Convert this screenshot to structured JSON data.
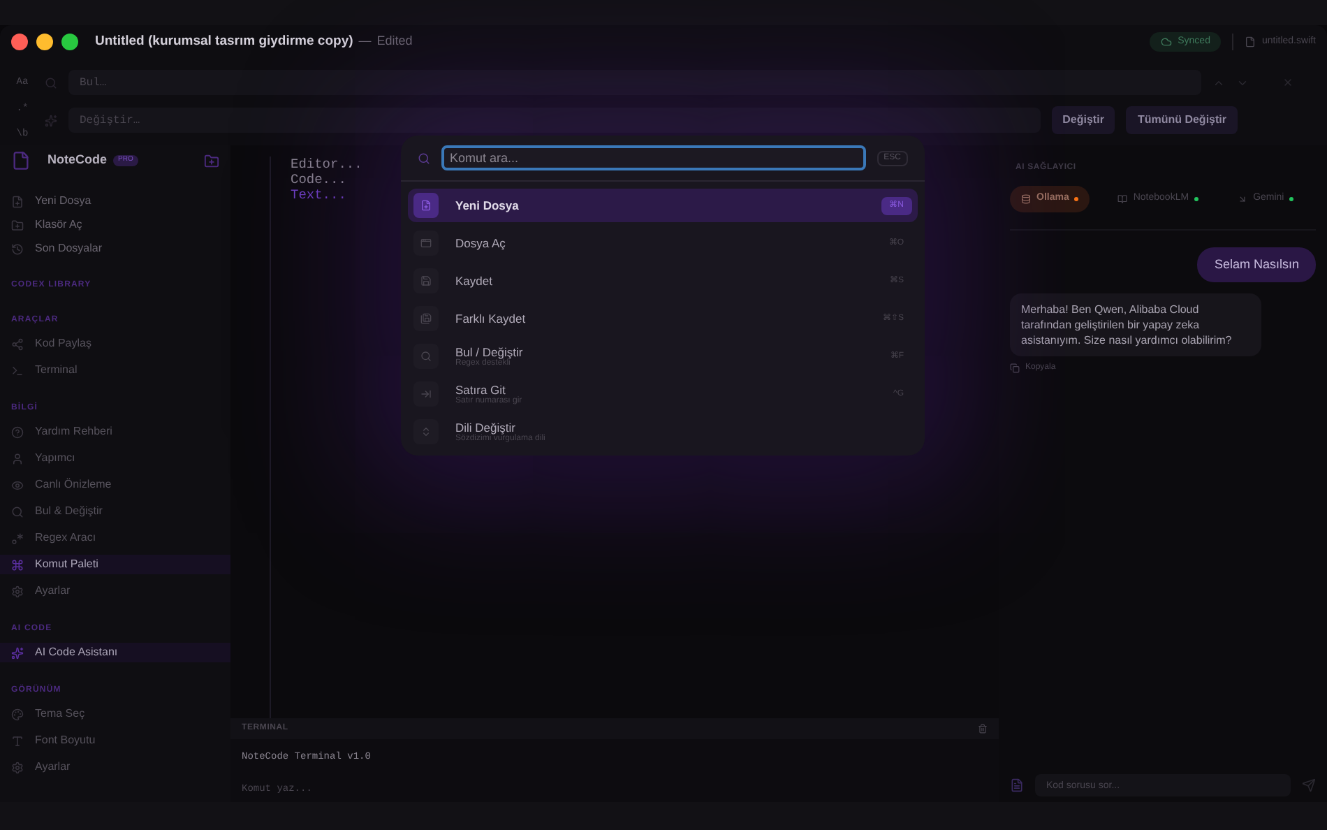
{
  "window": {
    "title": "Untitled (kurumsal tasrım giydirme copy)",
    "separator": "—",
    "edited": "Edited",
    "sync": "Synced",
    "file": "untitled.swift"
  },
  "find": {
    "toggles": [
      "Aa",
      ".*",
      "\\b"
    ],
    "find_placeholder": "Bul…",
    "replace_placeholder": "Değiştir…",
    "replace_button": "Değiştir",
    "replace_all_button": "Tümünü Değiştir"
  },
  "sidebar": {
    "brand": "NoteCode",
    "badge": "PRO",
    "top_items": [
      {
        "label": "Yeni Dosya"
      },
      {
        "label": "Klasör Aç"
      },
      {
        "label": "Son Dosyalar"
      }
    ],
    "sections": [
      {
        "title": "CODEX LIBRARY"
      },
      {
        "title": "ARAÇLAR",
        "items": [
          {
            "label": "Kod Paylaş",
            "selected": false
          },
          {
            "label": "Terminal",
            "selected": false
          }
        ]
      },
      {
        "title": "BİLGİ",
        "items": [
          {
            "label": "Yardım Rehberi",
            "selected": false
          },
          {
            "label": "Yapımcı",
            "selected": false
          },
          {
            "label": "Canlı Önizleme",
            "selected": false
          },
          {
            "label": "Bul & Değiştir",
            "selected": false
          },
          {
            "label": "Regex Aracı",
            "selected": false
          },
          {
            "label": "Komut Paleti",
            "selected": true
          },
          {
            "label": "Ayarlar",
            "selected": false
          }
        ]
      },
      {
        "title": "AI CODE",
        "items": [
          {
            "label": "AI Code Asistanı",
            "selected": true
          }
        ]
      },
      {
        "title": "GÖRÜNÜM",
        "items": [
          {
            "label": "Tema Seç",
            "selected": false
          },
          {
            "label": "Font Boyutu",
            "selected": false
          },
          {
            "label": "Ayarlar",
            "selected": false
          }
        ]
      }
    ]
  },
  "editor": {
    "lines": [
      "Editor...",
      "Code...",
      "Text..."
    ]
  },
  "terminal": {
    "title": "TERMINAL",
    "output": "NoteCode Terminal v1.0",
    "placeholder": "Komut yaz..."
  },
  "ai_panel": {
    "title": "AI SAĞLAYICI",
    "providers": [
      {
        "label": "Ollama",
        "selected": true,
        "color": "#f97316"
      },
      {
        "label": "NotebookLM",
        "selected": false,
        "color": "#22c55e"
      },
      {
        "label": "Gemini",
        "selected": false,
        "color": "#22c55e"
      }
    ],
    "messages": [
      {
        "kind": "user",
        "text": "Selam Nasılsın"
      },
      {
        "kind": "bot",
        "text": "Merhaba! Ben Qwen, Alibaba Cloud tarafından geliştirilen bir yapay zeka asistanıyım. Size nasıl yardımcı olabilirim?",
        "action": "Kopyala"
      }
    ],
    "input_placeholder": "Kod sorusu sor..."
  },
  "palette": {
    "placeholder": "Komut ara...",
    "esc": "ESC",
    "items": [
      {
        "label": "Yeni Dosya",
        "shortcut": "⌘N",
        "selected": true
      },
      {
        "label": "Dosya Aç",
        "shortcut": "⌘O",
        "selected": false
      },
      {
        "label": "Kaydet",
        "shortcut": "⌘S",
        "selected": false
      },
      {
        "label": "Farklı Kaydet",
        "shortcut": "⌘⇧S",
        "selected": false
      },
      {
        "label": "Bul / Değiştir",
        "hint": "Regex destekli",
        "shortcut": "⌘F",
        "selected": false
      },
      {
        "label": "Satıra Git",
        "hint": "Satır numarası gir",
        "shortcut": "^G",
        "selected": false
      },
      {
        "label": "Dili Değiştir",
        "hint": "Sözdizimi vurgulama dili",
        "selected": false
      }
    ]
  }
}
